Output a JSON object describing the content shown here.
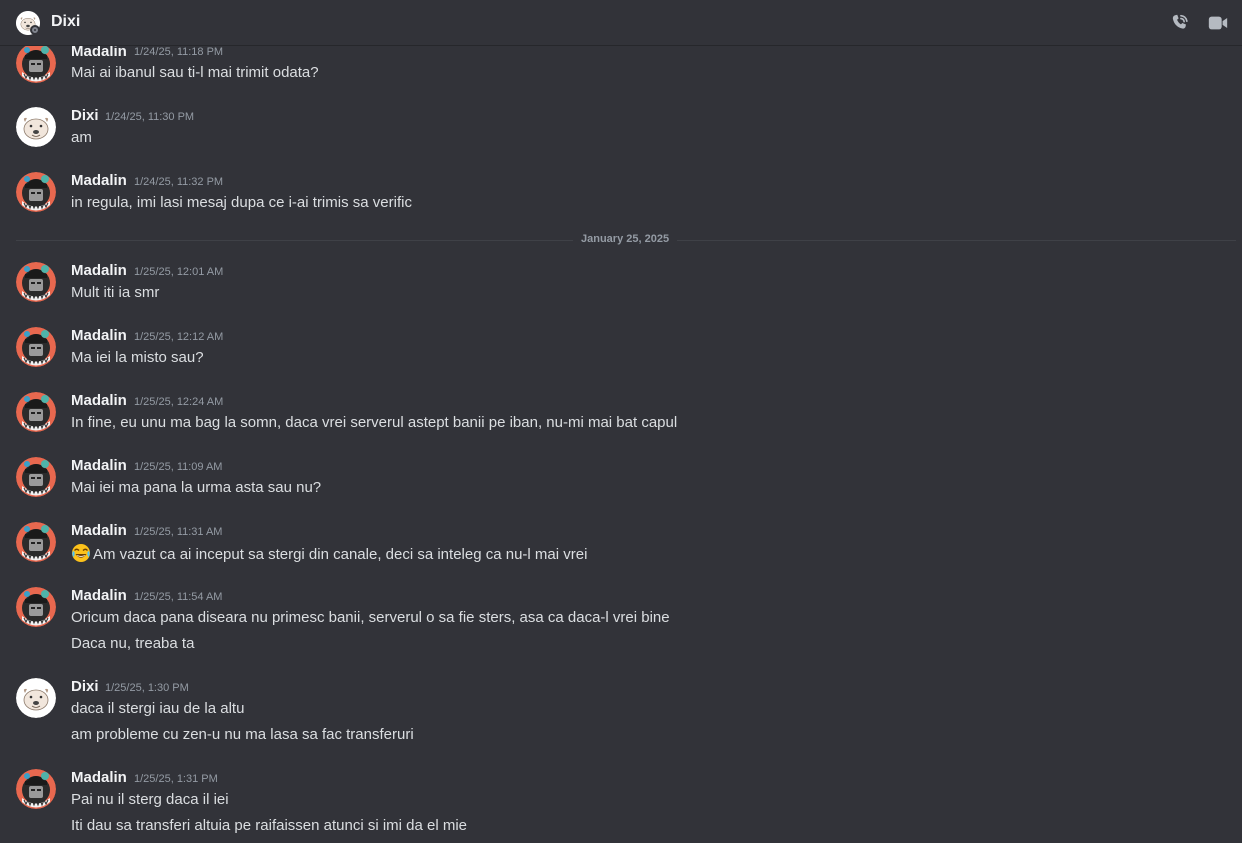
{
  "header": {
    "name": "Dixi",
    "call_icon": "phone-icon",
    "video_icon": "video-camera-icon"
  },
  "divider": {
    "label": "January 25, 2025"
  },
  "messages": [
    {
      "author": "Madalin",
      "time": "1/24/25, 11:18 PM",
      "lines": [
        "Mai ai ibanul sau ti-l mai trimit odata?"
      ]
    },
    {
      "author": "Dixi",
      "time": "1/24/25, 11:30 PM",
      "lines": [
        "am"
      ]
    },
    {
      "author": "Madalin",
      "time": "1/24/25, 11:32 PM",
      "lines": [
        "in regula, imi lasi mesaj dupa ce i-ai trimis sa verific"
      ]
    },
    {
      "author": "Madalin",
      "time": "1/25/25, 12:01 AM",
      "lines": [
        "Mult iti ia smr"
      ]
    },
    {
      "author": "Madalin",
      "time": "1/25/25, 12:12 AM",
      "lines": [
        "Ma iei la misto sau?"
      ]
    },
    {
      "author": "Madalin",
      "time": "1/25/25, 12:24 AM",
      "lines": [
        "In fine, eu unu ma bag la somn, daca vrei serverul astept banii pe iban, nu-mi mai bat capul"
      ]
    },
    {
      "author": "Madalin",
      "time": "1/25/25, 11:09 AM",
      "lines": [
        "Mai iei ma pana la urma asta sau nu?"
      ]
    },
    {
      "author": "Madalin",
      "time": "1/25/25, 11:31 AM",
      "lines": [
        "Am vazut ca ai inceput sa stergi din canale, deci sa inteleg ca nu-l mai vrei"
      ]
    },
    {
      "author": "Madalin",
      "time": "1/25/25, 11:54 AM",
      "lines": [
        "Oricum daca pana diseara nu primesc banii, serverul o sa fie sters, asa ca daca-l vrei bine",
        "Daca nu, treaba ta"
      ]
    },
    {
      "author": "Dixi",
      "time": "1/25/25, 1:30 PM",
      "lines": [
        "daca il stergi iau de la altu",
        "am probleme cu zen-u nu ma lasa sa fac transferuri"
      ]
    },
    {
      "author": "Madalin",
      "time": "1/25/25, 1:31 PM",
      "lines": [
        "Pai nu il sterg daca il iei",
        "Iti dau sa transferi altuia pe raifaissen atunci si imi da el mie"
      ]
    }
  ]
}
